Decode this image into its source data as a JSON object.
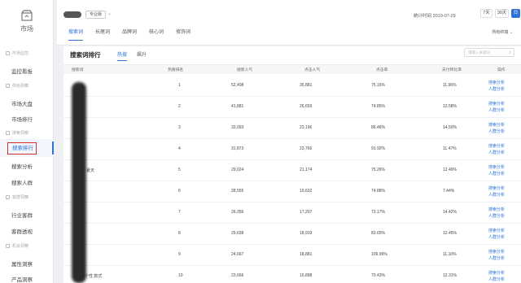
{
  "sidebar": {
    "logo_label": "市场",
    "groups": [
      {
        "label": "市场监控",
        "items": [
          "监控看板"
        ]
      },
      {
        "label": "供给洞察",
        "items": [
          "市场大盘",
          "市场排行"
        ]
      },
      {
        "label": "搜索洞察",
        "items": [
          "搜索排行",
          "搜索分析",
          "搜索人群"
        ]
      },
      {
        "label": "客群洞察",
        "items": [
          "行业客群",
          "客群透视"
        ]
      },
      {
        "label": "机会洞察",
        "items": [
          "属性洞察",
          "产品洞察"
        ]
      }
    ],
    "active_item": "搜索排行"
  },
  "header": {
    "dark_badge": "",
    "version_badge": "专业版",
    "stat_time": "统计时间 2019-07-29",
    "ranges": [
      "7天",
      "30天",
      "日"
    ],
    "active_range": "日",
    "calendar_icon": "calendar-icon",
    "tabs": [
      "搜索词",
      "长尾词",
      "品牌词",
      "核心词",
      "修饰词"
    ],
    "active_tab": "搜索词",
    "channel": "所有终端"
  },
  "card": {
    "title": "搜索词排行",
    "sub_tabs": [
      "热搜",
      "飙升"
    ],
    "active_sub_tab": "热搜",
    "search_placeholder": "请输入关键词",
    "columns": [
      "搜索词",
      "热搜排名",
      "搜索人气",
      "点击人气",
      "点击率",
      "支付转化率",
      "操作"
    ],
    "rows": [
      {
        "keyword": "",
        "rank": "1",
        "search_pop": "52,408",
        "click_pop": "35,881",
        "ctr": "75.16%",
        "conv": "11.96%"
      },
      {
        "keyword": "",
        "rank": "2",
        "search_pop": "41,881",
        "click_pop": "26,659",
        "ctr": "74.85%",
        "conv": "12.58%"
      },
      {
        "keyword": "",
        "rank": "3",
        "search_pop": "33,093",
        "click_pop": "23,196",
        "ctr": "86.46%",
        "conv": "14.50%"
      },
      {
        "keyword": "",
        "rank": "4",
        "search_pop": "31,873",
        "click_pop": "23,766",
        "ctr": "91.92%",
        "conv": "11.47%"
      },
      {
        "keyword": "夏天",
        "rank": "5",
        "search_pop": "29,024",
        "click_pop": "21,174",
        "ctr": "75.26%",
        "conv": "12.49%"
      },
      {
        "keyword": "",
        "rank": "6",
        "search_pop": "28,555",
        "click_pop": "19,632",
        "ctr": "74.88%",
        "conv": "7.44%"
      },
      {
        "keyword": "",
        "rank": "7",
        "search_pop": "26,356",
        "click_pop": "17,207",
        "ctr": "73.17%",
        "conv": "14.42%"
      },
      {
        "keyword": "",
        "rank": "8",
        "search_pop": "25,038",
        "click_pop": "18,919",
        "ctr": "83.65%",
        "conv": "12.45%"
      },
      {
        "keyword": "",
        "rank": "9",
        "search_pop": "24,667",
        "click_pop": "18,881",
        "ctr": "109.99%",
        "conv": "11.10%"
      },
      {
        "keyword": "个性 款式",
        "rank": "10",
        "search_pop": "23,666",
        "click_pop": "16,898",
        "ctr": "70.43%",
        "conv": "12.31%"
      }
    ],
    "action_1": "搜索分析",
    "action_2": "人群分析"
  }
}
